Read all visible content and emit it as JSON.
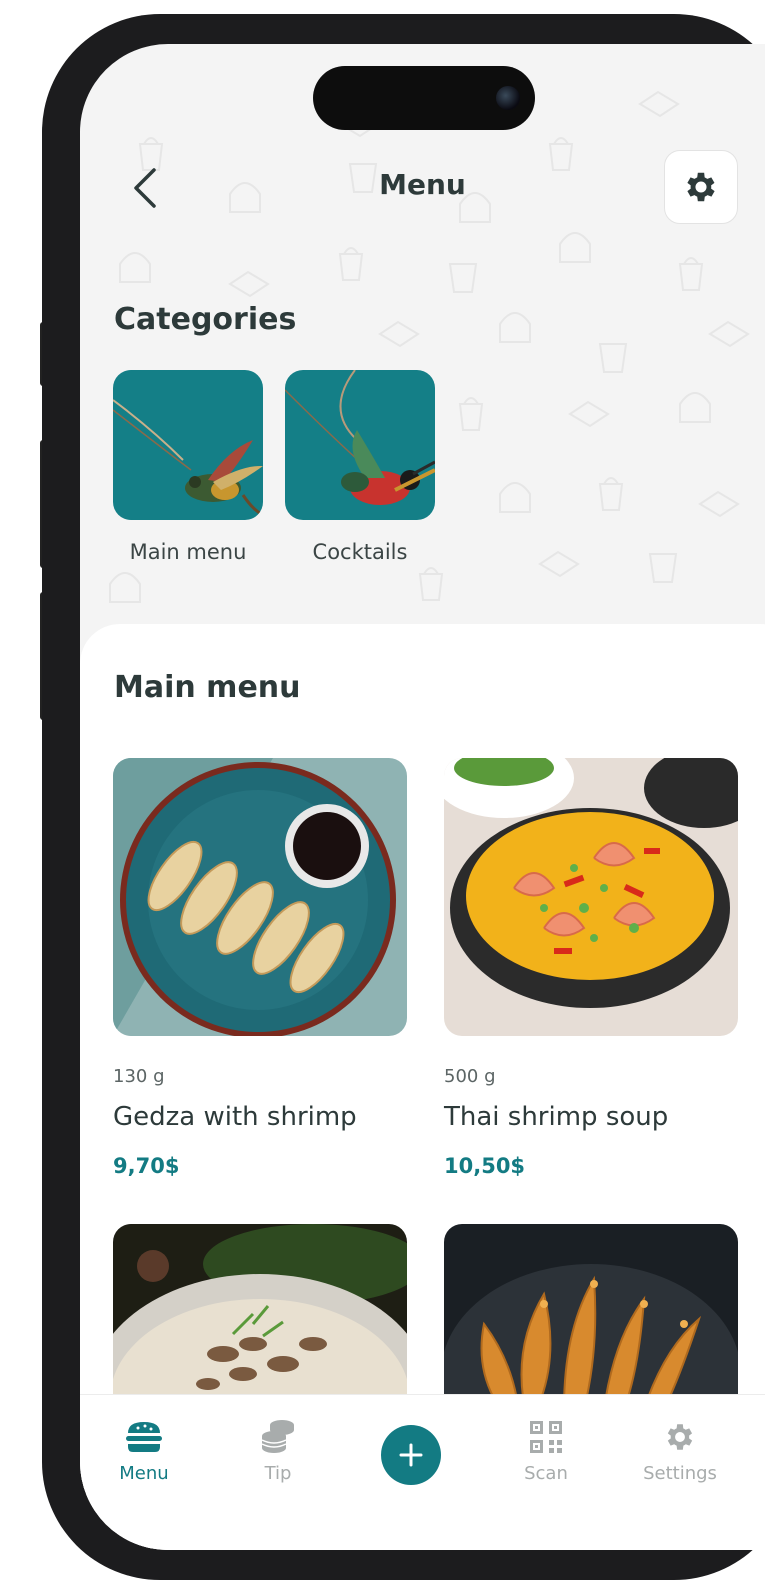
{
  "header": {
    "title": "Menu"
  },
  "categories": {
    "title": "Categories",
    "items": [
      {
        "label": "Main menu"
      },
      {
        "label": "Cocktails"
      }
    ]
  },
  "main_menu": {
    "title": "Main menu",
    "dishes": [
      {
        "weight": "130 g",
        "name": "Gedza with shrimp",
        "price": "9,70$"
      },
      {
        "weight": "500 g",
        "name": "Thai shrimp soup",
        "price": "10,50$"
      }
    ]
  },
  "tabbar": {
    "items": [
      {
        "label": "Menu",
        "icon": "burger-icon",
        "active": true
      },
      {
        "label": "Tip",
        "icon": "coins-icon",
        "active": false
      },
      {
        "label": "",
        "icon": "plus-icon",
        "active": false
      },
      {
        "label": "Scan",
        "icon": "qr-code-icon",
        "active": false
      },
      {
        "label": "Settings",
        "icon": "gear-icon",
        "active": false
      }
    ]
  },
  "colors": {
    "accent": "#137b83",
    "category_bg": "#147f87",
    "text_dark": "#2d3a3a",
    "inactive": "#a8acac"
  }
}
